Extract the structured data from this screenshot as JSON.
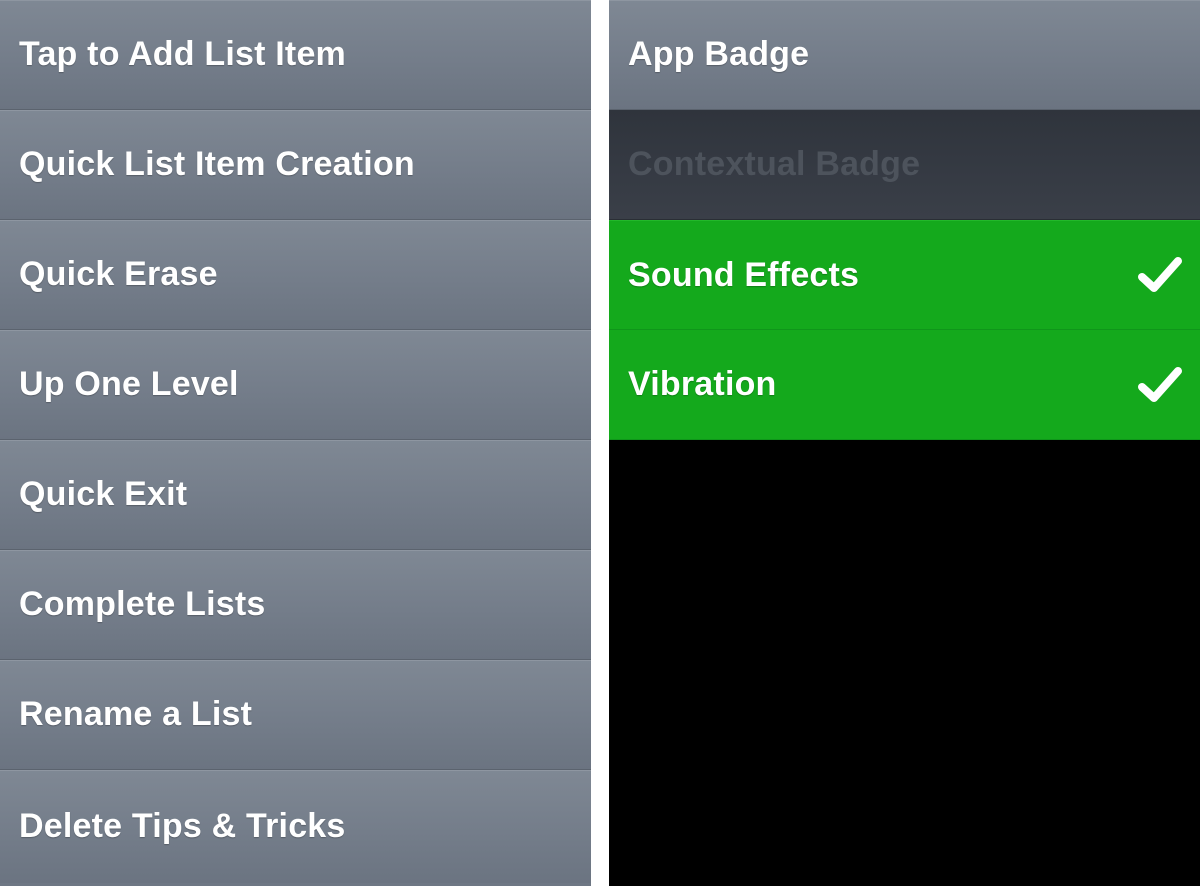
{
  "tips_menu": {
    "items": [
      {
        "label": "Tap to Add List Item"
      },
      {
        "label": "Quick List Item Creation"
      },
      {
        "label": "Quick Erase"
      },
      {
        "label": "Up One Level"
      },
      {
        "label": "Quick Exit"
      },
      {
        "label": "Complete Lists"
      },
      {
        "label": "Rename a List"
      },
      {
        "label": "Delete Tips & Tricks"
      }
    ]
  },
  "settings_menu": {
    "items": [
      {
        "label": "App Badge",
        "state": "off"
      },
      {
        "label": "Contextual Badge",
        "state": "disabled"
      },
      {
        "label": "Sound Effects",
        "state": "checked",
        "icon": "checkmark-icon"
      },
      {
        "label": "Vibration",
        "state": "checked",
        "icon": "checkmark-icon"
      }
    ]
  },
  "colors": {
    "row_gray": "#747d8a",
    "row_dark": "#353a43",
    "row_green": "#14a91c",
    "text_white": "#ffffff",
    "text_disabled": "#4d535c",
    "divider": "#ffffff",
    "background_black": "#000000"
  }
}
